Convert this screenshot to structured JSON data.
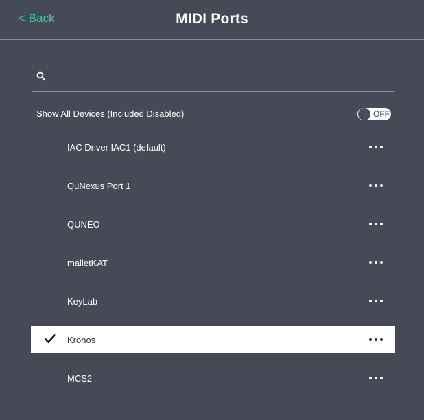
{
  "header": {
    "back_label": "< Back",
    "title": "MIDI Ports"
  },
  "search": {
    "placeholder": "",
    "value": ""
  },
  "show_all": {
    "label": "Show All Devices (Included Disabled)",
    "toggle_state": "OFF"
  },
  "devices": [
    {
      "name": "IAC Driver IAC1 (default)",
      "selected": false
    },
    {
      "name": "QuNexus Port 1",
      "selected": false
    },
    {
      "name": "QUNEO",
      "selected": false
    },
    {
      "name": "malletKAT",
      "selected": false
    },
    {
      "name": "KeyLab",
      "selected": false
    },
    {
      "name": "Kronos",
      "selected": true
    },
    {
      "name": "MCS2",
      "selected": false
    }
  ],
  "colors": {
    "background": "#464a56",
    "accent": "#3ec7a2",
    "divider": "#8a8e98",
    "selected_row": "#ffffff"
  },
  "icons": {
    "search": "search-icon",
    "more": "more-options-icon",
    "check": "checkmark-icon"
  }
}
